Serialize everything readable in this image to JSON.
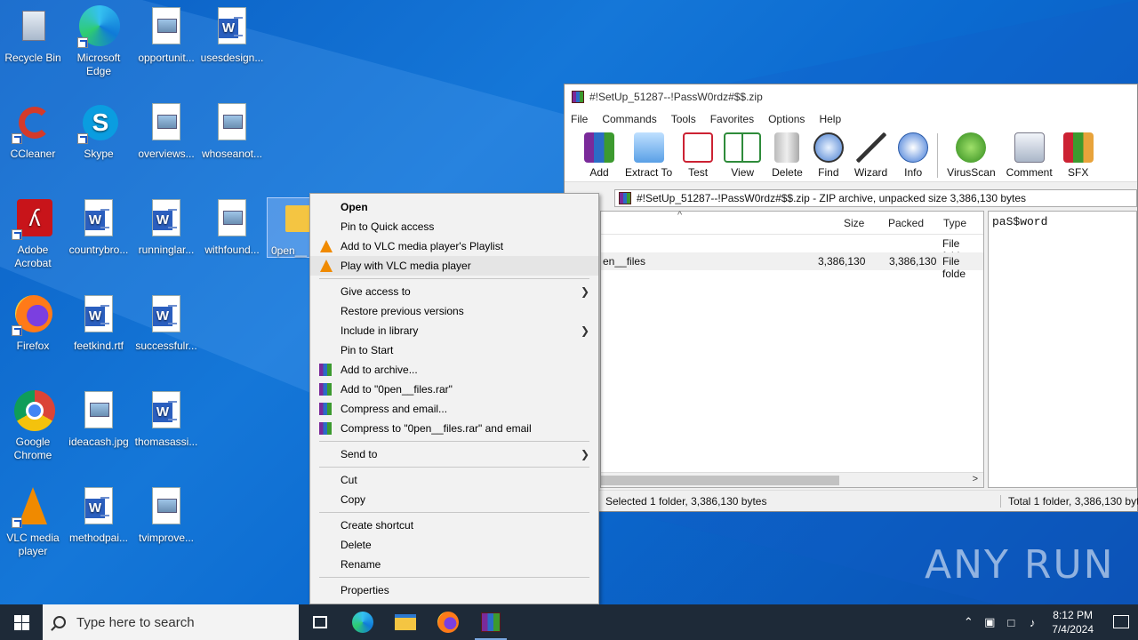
{
  "desktop": {
    "icons": [
      {
        "label": "Recycle Bin"
      },
      {
        "label": "Microsoft Edge"
      },
      {
        "label": "opportunit..."
      },
      {
        "label": "usesdesign..."
      },
      {
        "label": "CCleaner"
      },
      {
        "label": "Skype"
      },
      {
        "label": "overviews..."
      },
      {
        "label": "whoseanot..."
      },
      {
        "label": "Adobe Acrobat"
      },
      {
        "label": "countrybro..."
      },
      {
        "label": "runninglar..."
      },
      {
        "label": "withfound..."
      },
      {
        "label": "0pen__"
      },
      {
        "label": "Firefox"
      },
      {
        "label": "feetkind.rtf"
      },
      {
        "label": "successfulr..."
      },
      {
        "label": "Google Chrome"
      },
      {
        "label": "ideacash.jpg"
      },
      {
        "label": "thomasassi..."
      },
      {
        "label": "VLC media player"
      },
      {
        "label": "methodpai..."
      },
      {
        "label": "tvimprove..."
      }
    ]
  },
  "winrar": {
    "title": "#!SetUp_51287--!PassW0rdz#$$.zip",
    "menu": [
      "File",
      "Commands",
      "Tools",
      "Favorites",
      "Options",
      "Help"
    ],
    "toolbar": [
      "Add",
      "Extract To",
      "Test",
      "View",
      "Delete",
      "Find",
      "Wizard",
      "Info",
      "VirusScan",
      "Comment",
      "SFX"
    ],
    "path": "#!SetUp_51287--!PassW0rdz#$$.zip - ZIP archive, unpacked size 3,386,130 bytes",
    "columns": {
      "size": "Size",
      "packed": "Packed",
      "type": "Type"
    },
    "rows": [
      {
        "name": "",
        "size": "",
        "packed": "",
        "type": "File folde"
      },
      {
        "name": "en__files",
        "size": "3,386,130",
        "packed": "3,386,130",
        "type": "File folde"
      }
    ],
    "comment": "paS$word",
    "status_left": "Selected 1 folder, 3,386,130 bytes",
    "status_right": "Total 1 folder, 3,386,130 byte"
  },
  "context_menu": {
    "items": {
      "open": "Open",
      "pin_quick": "Pin to Quick access",
      "vlc_playlist": "Add to VLC media player's Playlist",
      "vlc_play": "Play with VLC media player",
      "give_access": "Give access to",
      "restore": "Restore previous versions",
      "include_lib": "Include in library",
      "pin_start": "Pin to Start",
      "add_archive": "Add to archive...",
      "add_rar": "Add to \"0pen__files.rar\"",
      "compress_email": "Compress and email...",
      "compress_rar_email": "Compress to \"0pen__files.rar\" and email",
      "send_to": "Send to",
      "cut": "Cut",
      "copy": "Copy",
      "create_shortcut": "Create shortcut",
      "delete": "Delete",
      "rename": "Rename",
      "properties": "Properties"
    }
  },
  "taskbar": {
    "search_placeholder": "Type here to search",
    "time": "8:12 PM",
    "date": "7/4/2024"
  },
  "watermark": "ANY RUN",
  "colors": {
    "taskbar_bg": "#1e2a38",
    "desktop_blue": "#0b6ad0",
    "menu_bg": "#f2f2f2",
    "highlight": "#e5e5e5"
  }
}
